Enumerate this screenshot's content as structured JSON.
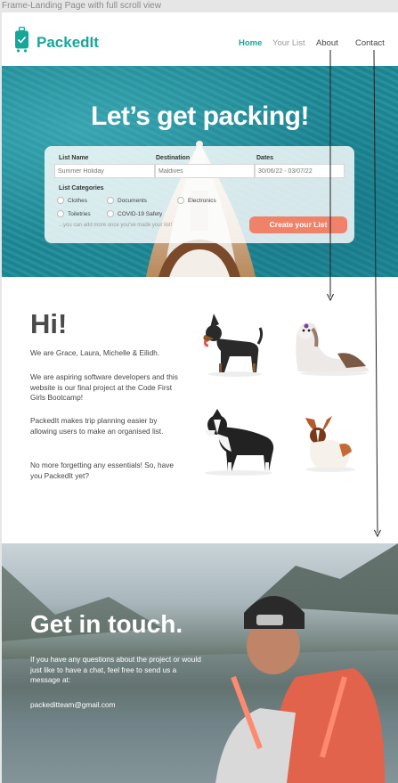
{
  "frame_label": "Frame-Landing Page with full scroll view",
  "brand": {
    "name": "PackedIt",
    "logo_icon": "suitcase-icon",
    "color": "#17a79a"
  },
  "nav": {
    "home": "Home",
    "your_list": "Your List",
    "about": "About",
    "contact": "Contact"
  },
  "hero": {
    "title": "Let’s get packing!",
    "list_name": {
      "label": "List Name",
      "placeholder": "Summer Holiday"
    },
    "destination": {
      "label": "Destination",
      "placeholder": "Maldives"
    },
    "dates": {
      "label": "Dates",
      "placeholder": "30/06/22 - 03/07/22"
    },
    "categories_label": "List Categories",
    "categories": [
      "Clothes",
      "Documents",
      "Electronics",
      "Toiletries",
      "COVID-19 Safety"
    ],
    "hint": "...you can add more once you've made your list!",
    "cta": "Create your List",
    "cta_color": "#f0826a"
  },
  "about": {
    "heading": "Hi!",
    "p1": "We are Grace, Laura, Michelle & Eilidh.",
    "p2": "We are aspiring software developers and this website is our final project at the Code First Girls Bootcamp!",
    "p3": "PackedIt makes trip planning easier by allowing users to make an organised list.",
    "p4": "No more forgetting any essentials! So, have you PackedIt yet?"
  },
  "contact": {
    "heading": "Get in touch.",
    "text": "If you have any questions about the project or would just like to have a chat, feel free to send us a message at:",
    "email": "packeditteam@gmail.com"
  }
}
